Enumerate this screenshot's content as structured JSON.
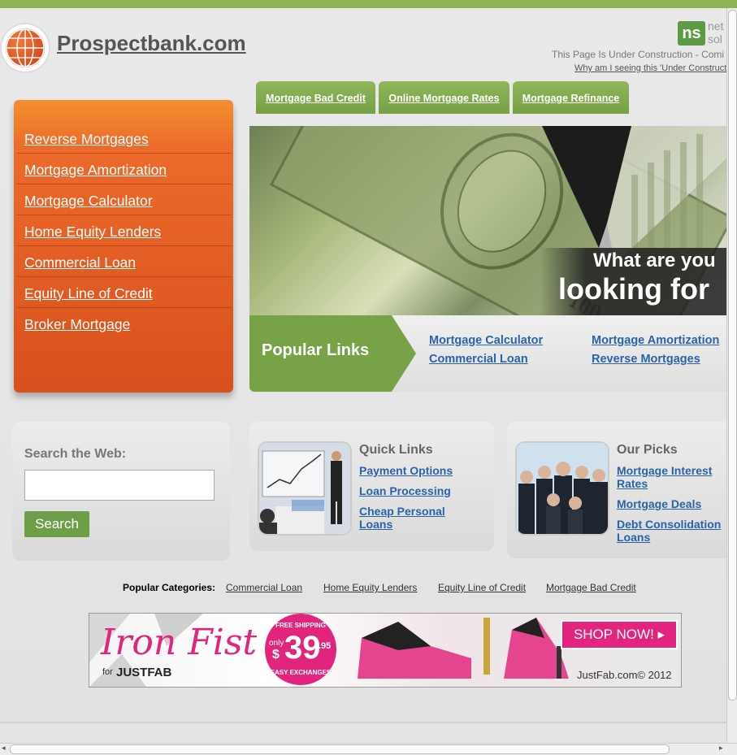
{
  "header": {
    "site_title": "Prospectbank.com",
    "partner_logo_text": "ns",
    "partner_name_partial": "net sol",
    "under_construction": "This Page Is Under Construction - Comi",
    "why_link": "Why am I seeing this 'Under Construct"
  },
  "tabs": [
    {
      "label": "Mortgage Bad Credit"
    },
    {
      "label": "Online Mortgage Rates"
    },
    {
      "label": "Mortgage Refinance"
    }
  ],
  "sidebar": {
    "items": [
      {
        "label": "Reverse Mortgages"
      },
      {
        "label": "Mortgage Amortization"
      },
      {
        "label": "Mortgage Calculator"
      },
      {
        "label": "Home Equity Lenders"
      },
      {
        "label": "Commercial Loan"
      },
      {
        "label": "Equity Line of Credit"
      },
      {
        "label": "Broker Mortgage"
      }
    ]
  },
  "hero": {
    "line1": "What are you",
    "line2": "looking for"
  },
  "popular_links": {
    "title": "Popular Links",
    "links": [
      {
        "label": "Mortgage Calculator"
      },
      {
        "label": "Commercial Loan"
      },
      {
        "label": "Mortgage Amortization"
      },
      {
        "label": "Reverse Mortgages"
      }
    ]
  },
  "search": {
    "label": "Search the Web:",
    "value": "",
    "button": "Search"
  },
  "quick_links": {
    "title": "Quick Links",
    "links": [
      {
        "label": "Payment Options"
      },
      {
        "label": "Loan Processing"
      },
      {
        "label": "Cheap Personal Loans"
      }
    ]
  },
  "our_picks": {
    "title": "Our Picks",
    "links": [
      {
        "label": "Mortgage Interest Rates"
      },
      {
        "label": "Mortgage Deals"
      },
      {
        "label": "Debt Consolidation Loans"
      }
    ]
  },
  "categories": {
    "label": "Popular Categories:",
    "links": [
      {
        "label": "Commercial Loan"
      },
      {
        "label": "Home Equity Lenders"
      },
      {
        "label": "Equity Line of Credit"
      },
      {
        "label": "Mortgage Bad Credit"
      }
    ]
  },
  "ad": {
    "brand": "Iron Fist",
    "for": "for",
    "partner": "JUSTFAB",
    "badge_top": "FREE SHIPPING",
    "badge_only": "only",
    "badge_dollar": "$",
    "badge_price": "39",
    "badge_cents": ".95",
    "badge_bottom": "EASY EXCHANGES",
    "cta": "SHOP NOW! ▸",
    "footer": "JustFab.com© 2012"
  },
  "colors": {
    "accent_green": "#7aa446",
    "sidebar_orange": "#e25f24",
    "link_blue": "#2a63a8"
  }
}
